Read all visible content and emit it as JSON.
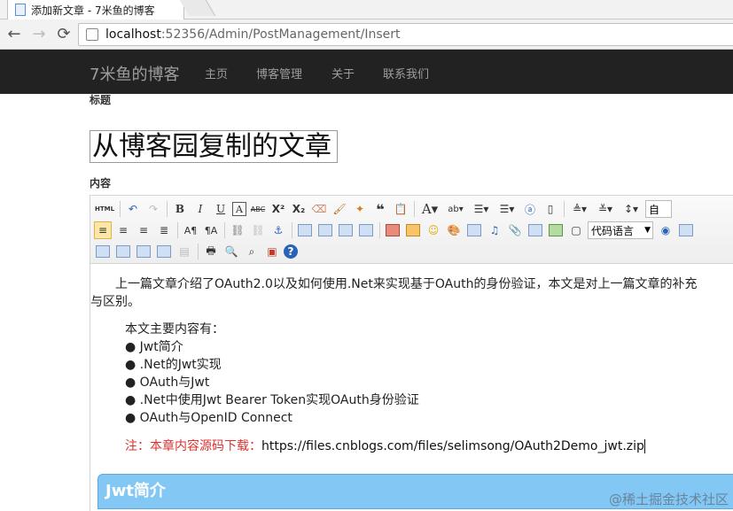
{
  "browser": {
    "tab_title": "添加新文章 - 7米鱼的博客",
    "url_host": "localhost",
    "url_path": ":52356/Admin/PostManagement/Insert"
  },
  "navbar": {
    "brand": "7米鱼的博客",
    "items": [
      "主页",
      "博客管理",
      "关于",
      "联系我们"
    ]
  },
  "form": {
    "title_label": "标题",
    "title_value": "从博客园复制的文章",
    "content_label": "内容"
  },
  "editor_toolbar": {
    "html_button": "HTML",
    "font_select": "代码语言",
    "partial_select": "自"
  },
  "editor_content": {
    "intro_line1": "上一篇文章介绍了OAuth2.0以及如何使用.Net来实现基于OAuth的身份验证，本文是对上一篇文章的补充",
    "intro_line2": "与区别。",
    "toc_heading": "本文主要内容有：",
    "toc_items": [
      "Jwt简介",
      ".Net的Jwt实现",
      "OAuth与Jwt",
      ".Net中使用Jwt Bearer Token实现OAuth身份验证",
      "OAuth与OpenID Connect"
    ],
    "download_label": "注：本章内容源码下载：",
    "download_url": "https://files.cnblogs.com/files/selimsong/OAuth2Demo_jwt.zip",
    "section_heading": "Jwt简介"
  },
  "watermark": "@稀土掘金技术社区",
  "colors": {
    "navbar_bg": "#222222",
    "section_bg": "#83c7f5",
    "download_label": "#e03030"
  }
}
